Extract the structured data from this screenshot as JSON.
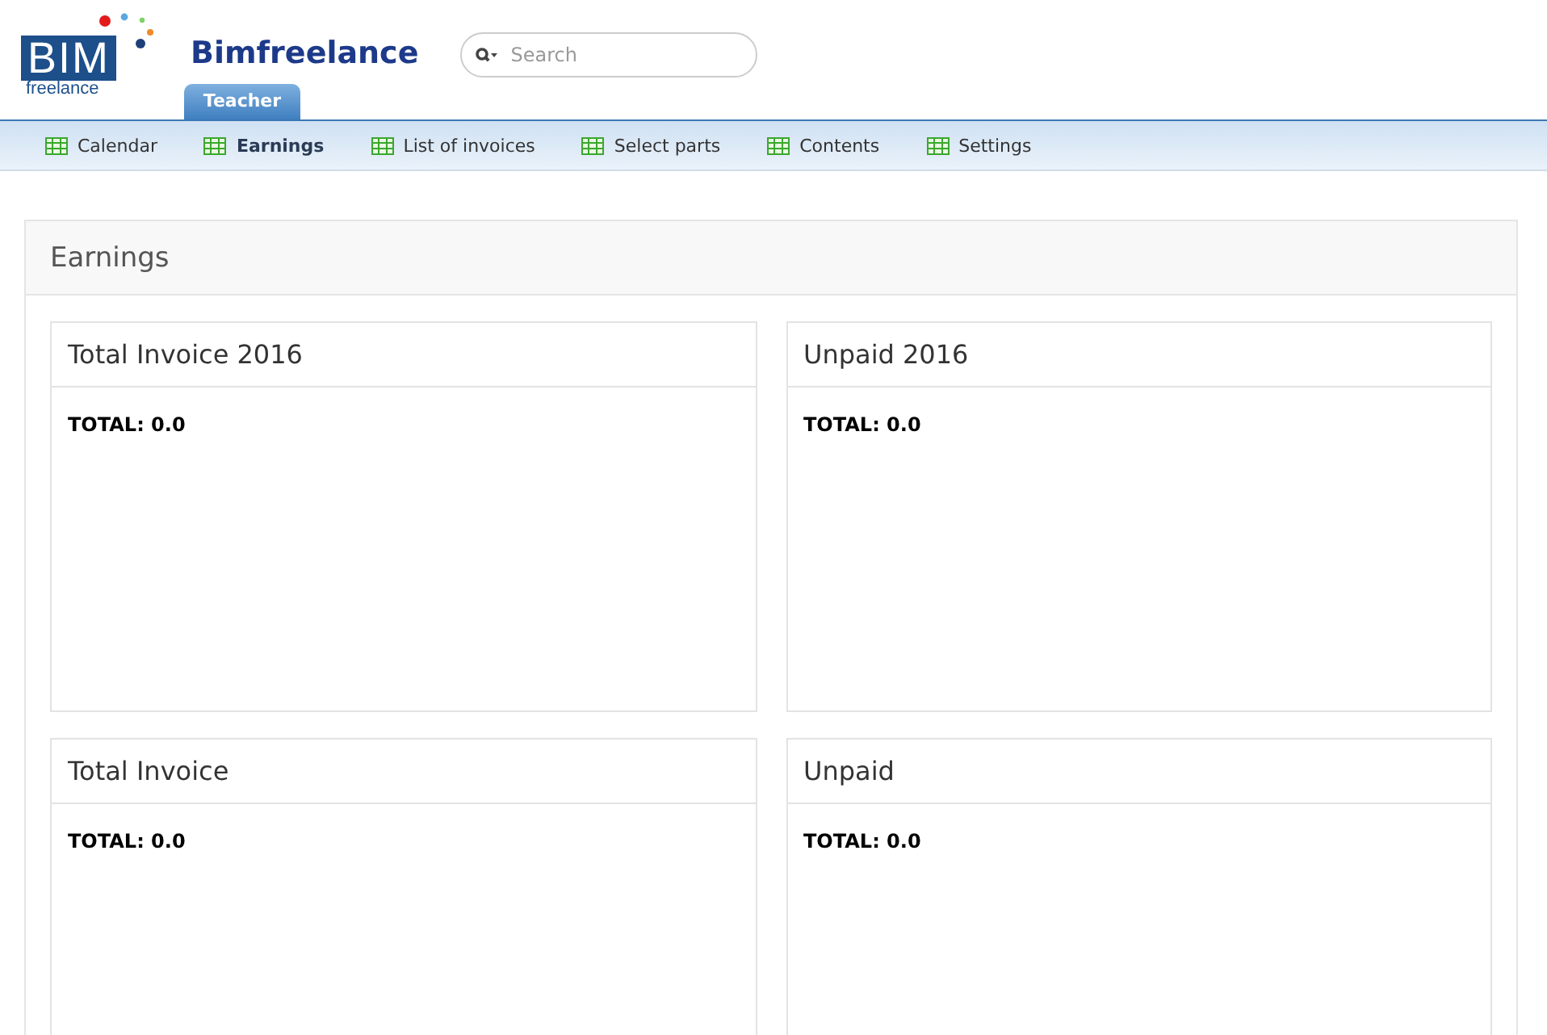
{
  "logo": {
    "mark": "BIM",
    "subtitle": "freelance"
  },
  "app_title": "Bimfreelance",
  "search": {
    "placeholder": "Search"
  },
  "role_tab": {
    "label": "Teacher",
    "selected": true
  },
  "nav": [
    {
      "label": "Calendar",
      "selected": false
    },
    {
      "label": "Earnings",
      "selected": true
    },
    {
      "label": "List of invoices",
      "selected": false
    },
    {
      "label": "Select parts",
      "selected": false
    },
    {
      "label": "Contents",
      "selected": false
    },
    {
      "label": "Settings",
      "selected": false
    }
  ],
  "panel": {
    "title": "Earnings",
    "cards": [
      {
        "title": "Total Invoice 2016",
        "total": "TOTAL: 0.0"
      },
      {
        "title": "Unpaid 2016",
        "total": "TOTAL: 0.0"
      },
      {
        "title": "Total Invoice",
        "total": "TOTAL: 0.0"
      },
      {
        "title": "Unpaid",
        "total": "TOTAL: 0.0"
      }
    ]
  }
}
